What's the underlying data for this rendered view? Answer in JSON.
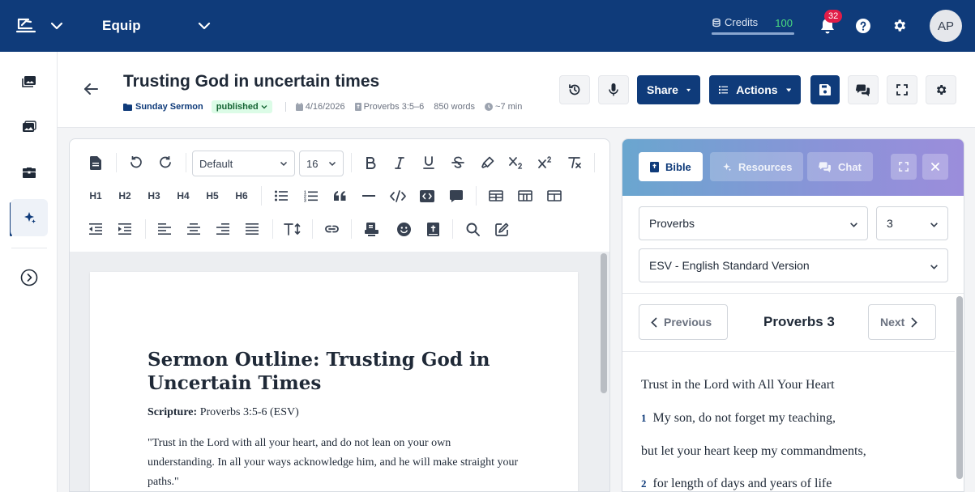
{
  "topbar": {
    "workspace": "Equip",
    "credits_label": "Credits",
    "credits_value": "100",
    "credits_fill_fraction": 1.0,
    "notifications_count": "32",
    "avatar_initials": "AP",
    "brand_color": "#0f3b7a"
  },
  "rail": {
    "items": [
      {
        "name": "media-library-icon"
      },
      {
        "name": "gallery-icon"
      },
      {
        "name": "toolbox-icon"
      },
      {
        "name": "ai-sparkle-icon",
        "active": true
      },
      {
        "name": "expand-circle-icon"
      }
    ]
  },
  "header": {
    "title": "Trusting God in uncertain times",
    "folder": "Sunday Sermon",
    "status": "published",
    "date": "4/16/2026",
    "scripture_ref": "Proverbs 3:5–6",
    "word_count": "850 words",
    "read_time": "~7 min",
    "share_label": "Share",
    "actions_label": "Actions"
  },
  "toolbar": {
    "font_family": "Default",
    "font_size": "16",
    "headings": [
      "H1",
      "H2",
      "H3",
      "H4",
      "H5",
      "H6"
    ]
  },
  "document": {
    "heading": "Sermon Outline: Trusting God in Uncertain Times",
    "scripture_label": "Scripture:",
    "scripture_value": " Proverbs 3:5-6 (ESV)",
    "quote": "\"Trust in the Lord with all your heart, and do not lean on your own understanding. In all your ways acknowledge him, and he will make straight your paths.\""
  },
  "panel": {
    "tabs": [
      {
        "label": "Bible",
        "active": true
      },
      {
        "label": "Resources",
        "active": false
      },
      {
        "label": "Chat",
        "active": false
      }
    ],
    "book": "Proverbs",
    "chapter": "3",
    "version": "ESV - English Standard Version",
    "prev_label": "Previous",
    "next_label": "Next",
    "chapter_title": "Proverbs 3",
    "section_heading": "Trust in the Lord with All Your Heart",
    "verses": [
      {
        "num": "1",
        "text": "My son, do not forget my teaching,"
      },
      {
        "num": "",
        "text": "but let your heart keep my commandments,"
      },
      {
        "num": "2",
        "text": "for length of days and years of life"
      }
    ]
  }
}
